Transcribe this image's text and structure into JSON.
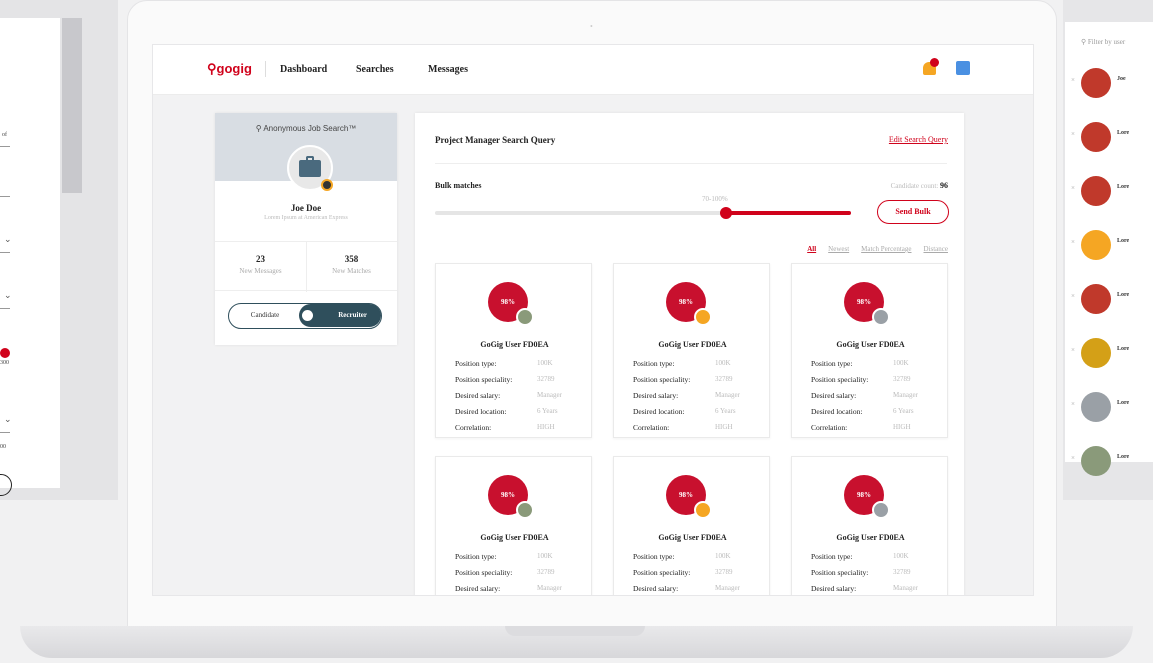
{
  "nav": {
    "logo": "gogig",
    "links": [
      "Dashboard",
      "Searches",
      "Messages"
    ]
  },
  "profile": {
    "anonymous_label": "Anonymous Job Search™",
    "name": "Joe Doe",
    "subtitle": "Lorem Ipsum at American Express",
    "messages_count": "23",
    "messages_label": "New Messages",
    "matches_count": "358",
    "matches_label": "New Matches",
    "toggle_left": "Candidate",
    "toggle_right": "Recruiter"
  },
  "search": {
    "title": "Project Manager Search Query",
    "edit_link": "Edit Search Query",
    "bulk_label": "Bulk matches",
    "candidate_count_label": "Candidate count:",
    "candidate_count": "96",
    "range_label": "70-100%",
    "range_min": 0.7,
    "range_max": 1.0,
    "send_bulk": "Send Bulk",
    "filters": [
      "All",
      "Newest",
      "Match Percentage",
      "Distance"
    ],
    "active_filter": "All"
  },
  "cards": [
    {
      "pct": "98%",
      "name": "GoGig User FD0EA",
      "fields": [
        [
          "Position type:",
          "100K"
        ],
        [
          "Position speciality:",
          "32789"
        ],
        [
          "Desired salary:",
          "Manager"
        ],
        [
          "Desired location:",
          "6 Years"
        ],
        [
          "Correlation:",
          "HIGH"
        ]
      ],
      "avatar_color": "#8a9a7a"
    },
    {
      "pct": "98%",
      "name": "GoGig User FD0EA",
      "fields": [
        [
          "Position type:",
          "100K"
        ],
        [
          "Position speciality:",
          "32789"
        ],
        [
          "Desired salary:",
          "Manager"
        ],
        [
          "Desired location:",
          "6 Years"
        ],
        [
          "Correlation:",
          "HIGH"
        ]
      ],
      "avatar_color": "#f5a623"
    },
    {
      "pct": "98%",
      "name": "GoGig User FD0EA",
      "fields": [
        [
          "Position type:",
          "100K"
        ],
        [
          "Position speciality:",
          "32789"
        ],
        [
          "Desired salary:",
          "Manager"
        ],
        [
          "Desired location:",
          "6 Years"
        ],
        [
          "Correlation:",
          "HIGH"
        ]
      ],
      "avatar_color": "#9aa0a6"
    },
    {
      "pct": "98%",
      "name": "GoGig User FD0EA",
      "fields": [
        [
          "Position type:",
          "100K"
        ],
        [
          "Position speciality:",
          "32789"
        ],
        [
          "Desired salary:",
          "Manager"
        ]
      ],
      "avatar_color": "#8a9a7a"
    },
    {
      "pct": "98%",
      "name": "GoGig User FD0EA",
      "fields": [
        [
          "Position type:",
          "100K"
        ],
        [
          "Position speciality:",
          "32789"
        ],
        [
          "Desired salary:",
          "Manager"
        ]
      ],
      "avatar_color": "#f5a623"
    },
    {
      "pct": "98%",
      "name": "GoGig User FD0EA",
      "fields": [
        [
          "Position type:",
          "100K"
        ],
        [
          "Position speciality:",
          "32789"
        ],
        [
          "Desired salary:",
          "Manager"
        ]
      ],
      "avatar_color": "#9aa0a6"
    }
  ],
  "side_right": {
    "search_placeholder": "Filter by user",
    "rows": [
      {
        "label": "Joe",
        "color": "#c0392b"
      },
      {
        "label": "Lore",
        "color": "#c0392b"
      },
      {
        "label": "Lore",
        "color": "#c0392b"
      },
      {
        "label": "Lore",
        "color": "#f5a623"
      },
      {
        "label": "Lore",
        "color": "#c0392b"
      },
      {
        "label": "Lore",
        "color": "#d4a017"
      },
      {
        "label": "Lore",
        "color": "#9aa0a6"
      },
      {
        "label": "Lore",
        "color": "#8a9a7a"
      }
    ]
  },
  "side_left": {
    "labels": [
      "of",
      "300",
      "00"
    ]
  },
  "colors": {
    "brand_red": "#d0021b",
    "dark_teal": "#2f4f5c"
  }
}
